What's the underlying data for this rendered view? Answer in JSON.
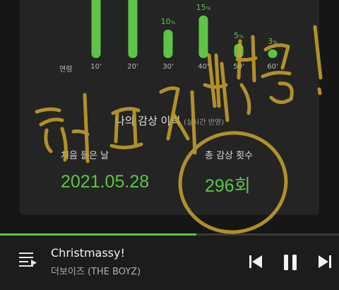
{
  "chart_data": {
    "type": "bar",
    "title": "",
    "xlabel": "연령",
    "categories": [
      "10'",
      "20'",
      "30'",
      "40'",
      "50'",
      "60'"
    ],
    "values": [
      null,
      null,
      10,
      15,
      5,
      3
    ],
    "value_labels": [
      "",
      "",
      "10",
      "15",
      "5",
      "3"
    ],
    "value_suffix": "%",
    "bar_color": "#5ec447"
  },
  "history": {
    "title": "나의 감상 이력",
    "subtitle": "(실시간 반영)",
    "first_listen_label": "처음 들은 날",
    "first_listen_value": "2021.05.28",
    "total_plays_label": "총 감상 횟수",
    "total_plays_value": "296회"
  },
  "player": {
    "track_title": "Christmassy!",
    "artist": "더보이즈 (THE BOYZ)",
    "progress": 0.58,
    "is_playing": true
  },
  "overlay": {
    "handwriting": "최애지분율!",
    "color": "#c9a52a"
  },
  "colors": {
    "accent": "#5ec447",
    "background": "#161616",
    "card": "#242424"
  }
}
